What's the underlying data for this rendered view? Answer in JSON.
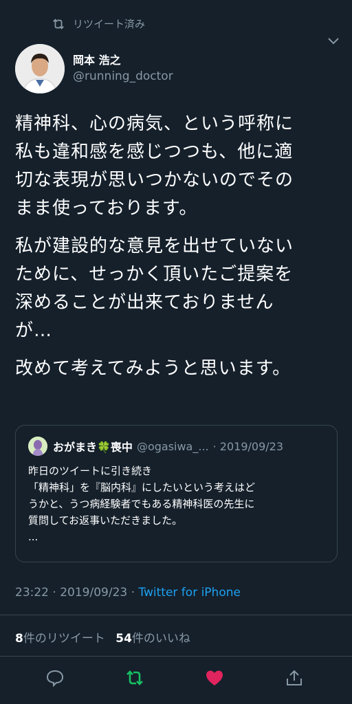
{
  "retweet_bar": {
    "label": "リツイート済み",
    "icon": "retweet-icon"
  },
  "author": {
    "name": "岡本 浩之",
    "handle": "@running_doctor"
  },
  "tweet": {
    "paragraphs": [
      "精神科、心の病気、という呼称に\n私も違和感を感じつつも、他に適\n切な表現が思いつかないのでその\nまま使っております。",
      "私が建設的な意見を出せていない\nために、せっかく頂いたご提案を\n深めることが出来ておりません\nが…",
      "改めて考えてみようと思います。"
    ]
  },
  "quote": {
    "name": "おがまき🍀喪中",
    "handle": "@ogasiwa_...",
    "date": "· 2019/09/23",
    "text": "昨日のツイートに引き続き\n「精神科」を『脳内科』にしたいという考えはど\nうかと、うつ病経験者でもある精神科医の先生に\n質問してお返事いただきました。\n..."
  },
  "meta": {
    "time": "23:22",
    "date": "2019/09/23",
    "separator": " · ",
    "source": "Twitter for iPhone"
  },
  "stats": {
    "retweet_count": "8",
    "retweet_label": "件のリツイート",
    "like_count": "54",
    "like_label": "件のいいね"
  },
  "colors": {
    "background": "#15202b",
    "secondary_text": "#8899a6",
    "link": "#1da1f2",
    "retweet_green": "#17bf63",
    "like_pink": "#e0245e"
  },
  "actions": [
    "reply-icon",
    "retweet-icon",
    "like-icon",
    "share-icon"
  ]
}
